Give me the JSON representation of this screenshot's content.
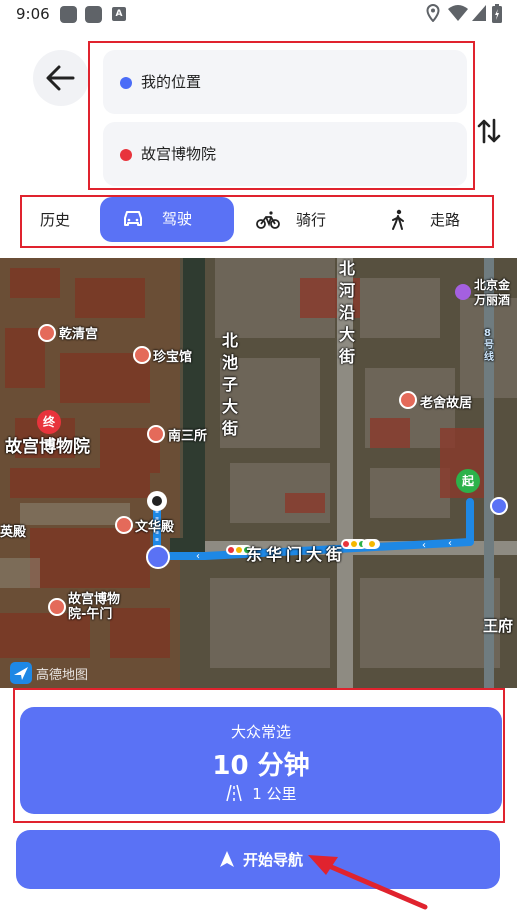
{
  "status_bar": {
    "time": "9:06",
    "notification_badge": "A"
  },
  "header": {
    "origin": "我的位置",
    "destination": "故宫博物院",
    "origin_color": "#4a6cf7",
    "destination_color": "#e8343c"
  },
  "modes": {
    "history": "历史",
    "drive": "驾驶",
    "ride": "骑行",
    "walk": "走路"
  },
  "map": {
    "labels": {
      "qianqing": "乾清宫",
      "zhenbao": "珍宝馆",
      "nansansuo": "南三所",
      "gugong": "故宫博物院",
      "wenhua": "文华殿",
      "ying": "英殿",
      "wumen": "故宫博物院-午门",
      "donghuamen": "东华门大街",
      "beichizi": "北池子大街",
      "beiheyan": "北河沿大街",
      "laoshe": "老舍故居",
      "beijing_wanli": "北京金万丽酒",
      "wangfu": "王府",
      "road_8": "8号线",
      "end_marker": "终",
      "start_marker": "起",
      "watermark": "高德地图"
    }
  },
  "route": {
    "label": "大众常选",
    "time": "10 分钟",
    "distance": "1 公里"
  },
  "nav_button": {
    "label": "开始导航"
  },
  "colors": {
    "accent": "#5a72f5",
    "highlight_border": "#e0232e"
  }
}
